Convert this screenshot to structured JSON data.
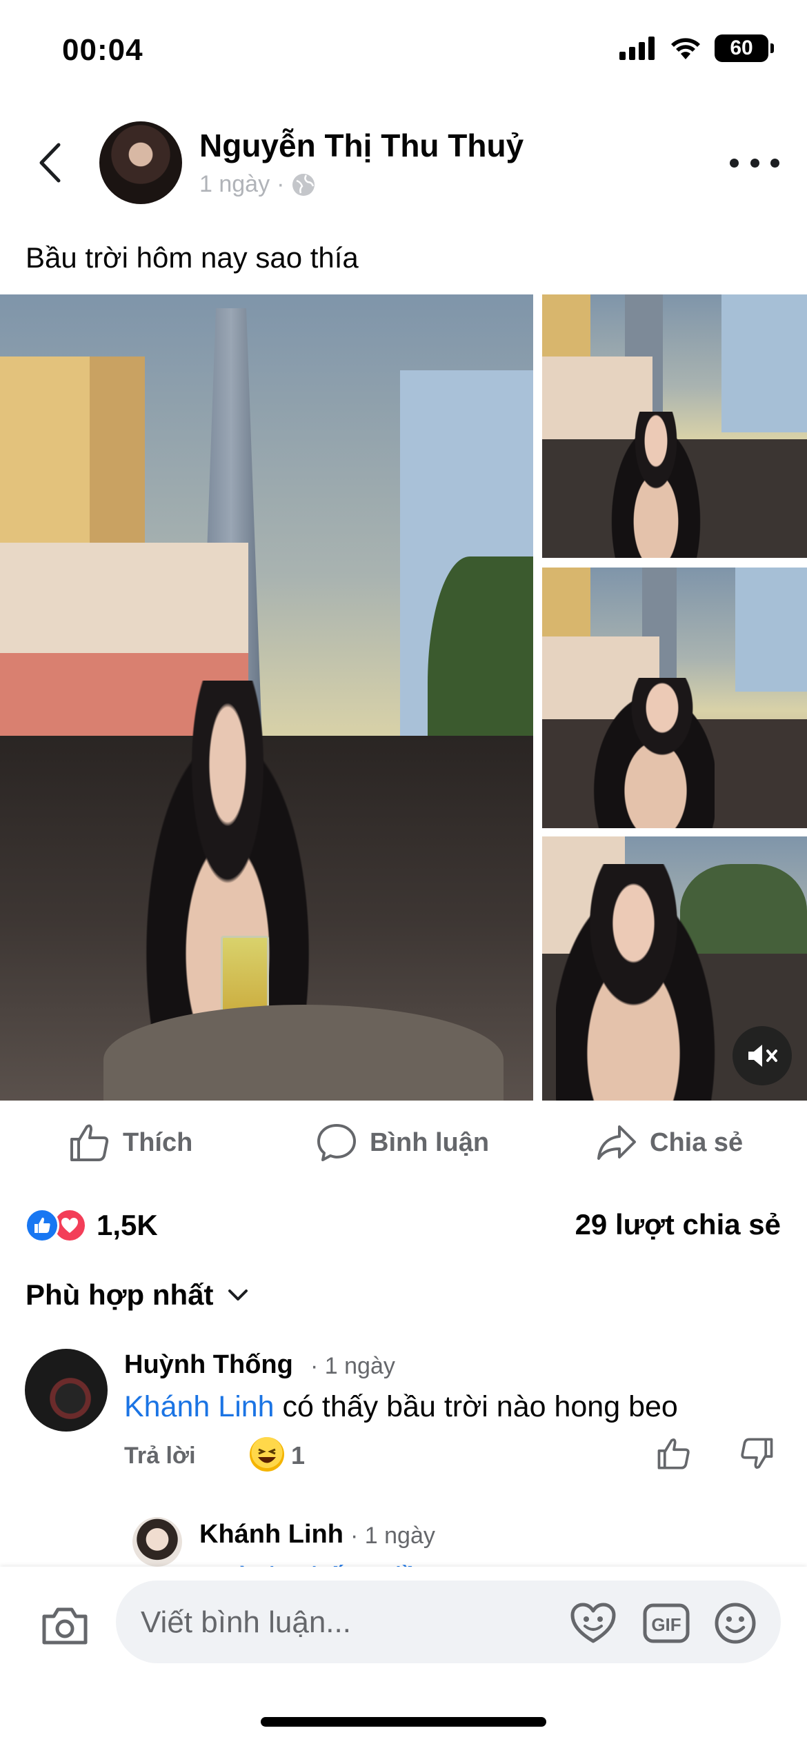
{
  "status_bar": {
    "time": "00:04",
    "battery": "60"
  },
  "post": {
    "author": "Nguyễn Thị Thu Thuỷ",
    "time": "1 ngày",
    "separator": "·",
    "text": "Bầu trời hôm nay sao thía"
  },
  "actions": {
    "like": "Thích",
    "comment": "Bình luận",
    "share": "Chia sẻ"
  },
  "reactions": {
    "count": "1,5K",
    "shares": "29 lượt chia sẻ"
  },
  "sort": {
    "label": "Phù hợp nhất"
  },
  "comments": [
    {
      "name": "Huỳnh Thống",
      "time": "· 1 ngày",
      "mention": "Khánh Linh",
      "text": " có thấy bầu trời nào hong beo",
      "reply": "Trả lời",
      "reaction_count": "1"
    },
    {
      "name": "Khánh Linh",
      "time": "· 1 ngày",
      "partial_text": "Huỳnh Thống  đều ..."
    }
  ],
  "composer": {
    "placeholder": "Viết bình luận...",
    "gif": "GIF"
  },
  "colors": {
    "link": "#1b74e4",
    "like": "#1877f2",
    "love": "#f33e58",
    "muted": "#65676b"
  }
}
